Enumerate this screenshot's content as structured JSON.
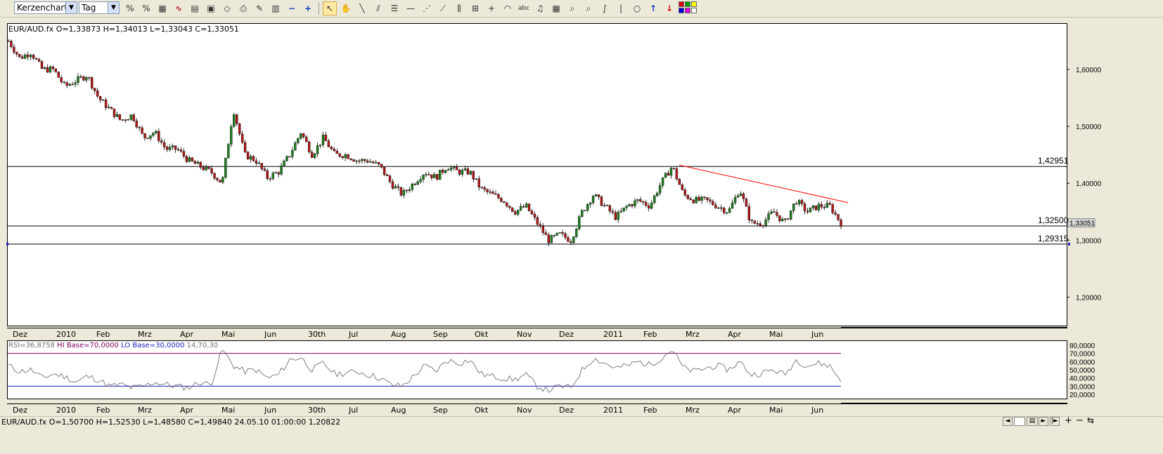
{
  "toolbar": {
    "chart_type": "Kerzenchart",
    "period": "Tag",
    "tools": [
      "scale-icon",
      "scale-alt-icon",
      "grid-icon",
      "indicator-icon",
      "template-icon",
      "image-icon",
      "erase-icon",
      "print-icon",
      "color-icon",
      "properties-icon",
      "zoom-out-icon",
      "zoom-in-icon",
      "cursor-icon",
      "hand-icon",
      "line-icon",
      "parallel-icon",
      "fibonacci-retracement-icon",
      "horizontal-line-icon",
      "fan-icon",
      "fibonacci-fan-icon",
      "fibonacci-time-icon",
      "gann-icon",
      "crosshair-icon",
      "arc-icon",
      "text-icon",
      "bell-icon",
      "calculator-icon",
      "magnifier-icon",
      "magnifier-plus-icon",
      "free-draw-icon",
      "vertical-bar-icon",
      "circle-icon",
      "arrow-up-icon",
      "arrow-down-icon",
      "color-palette-icon"
    ]
  },
  "main_chart": {
    "header": "EUR/AUD.fx O=1,33873 H=1,34013 L=1,33043 C=1,33051",
    "y_ticks": [
      "1,60000",
      "1,50000",
      "1,40000",
      "1,30000",
      "1,20000"
    ],
    "current_price": "1,33051",
    "levels": [
      {
        "label": "1,42951",
        "value": 1.42951
      },
      {
        "label": "1,32500",
        "value": 1.325
      },
      {
        "label": "1,29315",
        "value": 1.29315
      }
    ]
  },
  "x_axis_labels": [
    "Dez",
    "2010",
    "Feb",
    "Mrz",
    "Apr",
    "Mai",
    "Jun",
    "30th",
    "Jul",
    "Aug",
    "Sep",
    "Okt",
    "Nov",
    "Dez",
    "2011",
    "Feb",
    "Mrz",
    "Apr",
    "Mai",
    "Jun"
  ],
  "rsi": {
    "header_rsi": "RSI=36,8758",
    "header_hi": "HI Base=70,0000",
    "header_lo": "LO Base=30,0000",
    "header_params": "14,70,30",
    "y_ticks": [
      "80,0000",
      "70,0000",
      "60,0000",
      "50,0000",
      "40,0000",
      "30,0000",
      "20,0000"
    ],
    "hi_base": 70,
    "lo_base": 30
  },
  "status_bar": {
    "text": "EUR/AUD.fx O=1,50700 H=1,52530 L=1,48580 C=1,49840   24.05.10 01:00:00 1,20822"
  },
  "colors": {
    "bull": "#208020",
    "bear": "#b01818",
    "trendline": "#ff0000",
    "hi_base": "#800060",
    "lo_base": "#2020c0",
    "rsi_line": "#707070"
  },
  "chart_data": [
    {
      "type": "candlestick",
      "title": "EUR/AUD.fx",
      "ylim": [
        1.15,
        1.68
      ],
      "x_labels": [
        "Dez",
        "2010",
        "Feb",
        "Mrz",
        "Apr",
        "Mai",
        "Jun",
        "30th",
        "Jul",
        "Aug",
        "Sep",
        "Okt",
        "Nov",
        "Dez",
        "2011",
        "Feb",
        "Mrz",
        "Apr",
        "Mai",
        "Jun"
      ],
      "close_path": [
        1.65,
        1.62,
        1.63,
        1.6,
        1.6,
        1.57,
        1.58,
        1.59,
        1.55,
        1.53,
        1.51,
        1.52,
        1.48,
        1.49,
        1.46,
        1.46,
        1.44,
        1.43,
        1.42,
        1.4,
        1.53,
        1.45,
        1.44,
        1.41,
        1.42,
        1.45,
        1.49,
        1.45,
        1.48,
        1.45,
        1.45,
        1.44,
        1.44,
        1.43,
        1.4,
        1.38,
        1.4,
        1.42,
        1.41,
        1.43,
        1.42,
        1.42,
        1.39,
        1.38,
        1.37,
        1.35,
        1.36,
        1.33,
        1.3,
        1.31,
        1.3,
        1.35,
        1.38,
        1.36,
        1.34,
        1.36,
        1.37,
        1.36,
        1.4,
        1.43,
        1.38,
        1.37,
        1.37,
        1.36,
        1.35,
        1.39,
        1.33,
        1.33,
        1.35,
        1.33,
        1.37,
        1.35,
        1.36,
        1.36,
        1.33
      ]
    },
    {
      "type": "line",
      "title": "RSI",
      "ylim": [
        20,
        80
      ],
      "series": [
        {
          "name": "RSI",
          "values": [
            55,
            48,
            50,
            40,
            45,
            42,
            35,
            42,
            38,
            30,
            32,
            28,
            30,
            35,
            32,
            30,
            28,
            35,
            32,
            75,
            55,
            48,
            50,
            40,
            44,
            62,
            65,
            50,
            58,
            45,
            46,
            48,
            44,
            40,
            32,
            30,
            42,
            55,
            48,
            62,
            58,
            62,
            45,
            42,
            40,
            38,
            44,
            30,
            25,
            30,
            28,
            50,
            64,
            58,
            52,
            55,
            60,
            56,
            64,
            75,
            52,
            48,
            52,
            55,
            50,
            60,
            44,
            46,
            50,
            44,
            62,
            55,
            58,
            55,
            37
          ]
        }
      ]
    }
  ]
}
